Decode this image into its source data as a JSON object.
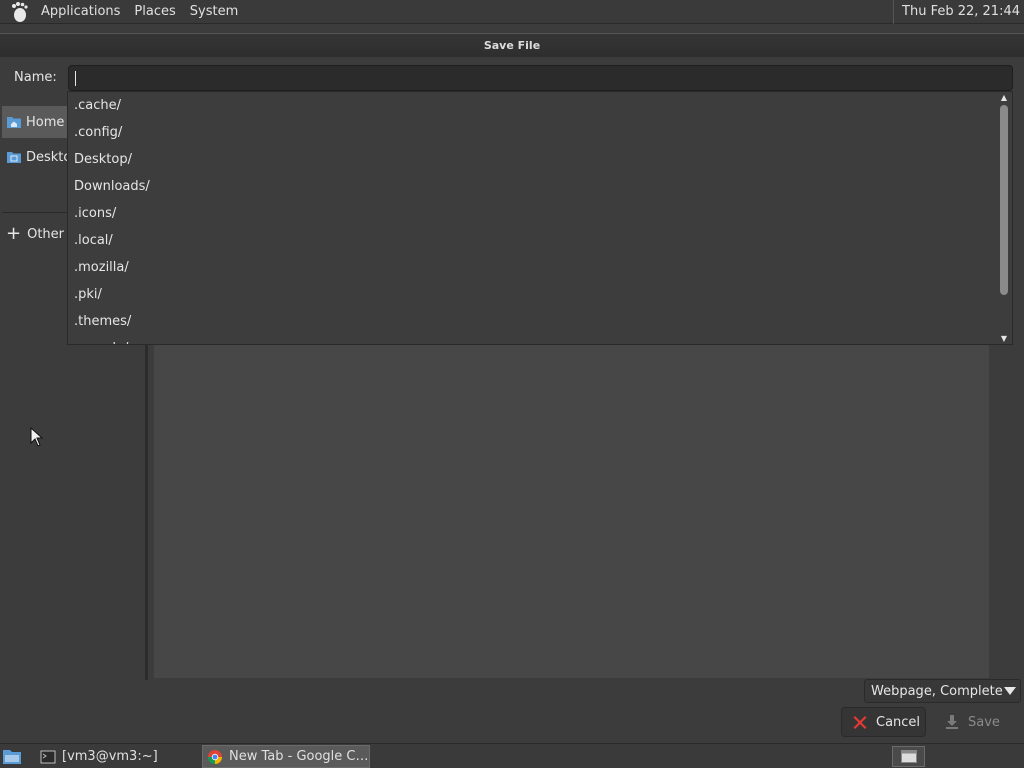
{
  "top_panel": {
    "menus": [
      "Applications",
      "Places",
      "System"
    ],
    "clock": "Thu Feb 22, 21:44"
  },
  "dialog": {
    "title": "Save File",
    "name_label": "Name:",
    "name_value": ""
  },
  "sidebar": {
    "items": [
      {
        "label": "Home",
        "icon": "home-folder-icon"
      },
      {
        "label": "Deskto",
        "icon": "desktop-folder-icon"
      },
      {
        "label": "Other L",
        "icon": "plus-icon"
      }
    ]
  },
  "dropdown": {
    "items": [
      ".cache/",
      ".config/",
      "Desktop/",
      "Downloads/",
      ".icons/",
      ".local/",
      ".mozilla/",
      ".pki/",
      ".themes/",
      ".vscode/"
    ]
  },
  "bottom": {
    "file_type": "Webpage, Complete",
    "cancel_label": "Cancel",
    "save_label": "Save"
  },
  "taskbar": {
    "tasks": [
      {
        "label": "[vm3@vm3:~]",
        "icon": "terminal-icon"
      },
      {
        "label": "New Tab - Google C…",
        "icon": "chrome-icon"
      }
    ]
  },
  "colors": {
    "panel_bg": "#3a3a3a",
    "dialog_bg": "#3c3c3c",
    "main_area_bg": "#474747",
    "cancel_icon": "#e53935",
    "folder_icon": "#5b9bd5"
  }
}
